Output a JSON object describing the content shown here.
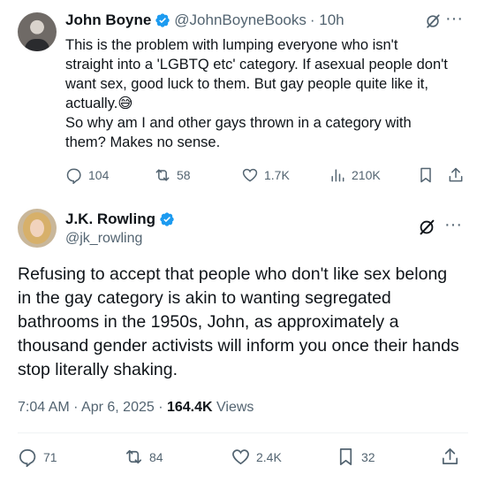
{
  "tweet1": {
    "author_name": "John Boyne",
    "author_handle": "@JohnBoyneBooks",
    "time": "· 10h",
    "text_lines": [
      "This is the problem with lumping everyone who isn't",
      "straight into a 'LGBTQ etc' category. If asexual people don't",
      "want sex, good luck to them. But gay people quite like it,",
      "actually.😅",
      "So why am I and other gays thrown in a category with",
      "them? Makes no sense."
    ],
    "replies": "104",
    "reposts": "58",
    "likes": "1.7K",
    "views": "210K",
    "icons": [
      "reply-icon",
      "repost-icon",
      "like-icon",
      "views-icon",
      "bookmark-icon",
      "share-icon",
      "grok-icon",
      "more-icon",
      "verified-icon"
    ]
  },
  "tweet2": {
    "author_name": "J.K. Rowling",
    "author_handle": "@jk_rowling",
    "text": "Refusing to accept that people who don't like sex belong in the gay category is akin to wanting segregated bathrooms in the 1950s, John, as approximately a thousand gender activists will inform you once their hands stop literally shaking.",
    "timestamp": "7:04 AM · Apr 6, 2025 · ",
    "views_count": "164.4K",
    "views_label": " Views",
    "replies": "71",
    "reposts": "84",
    "likes": "2.4K",
    "bookmarks": "32"
  },
  "colors": {
    "text": "#0f1419",
    "secondary": "#536471",
    "verified": "#1d9bf0",
    "divider": "#eff3f4"
  }
}
